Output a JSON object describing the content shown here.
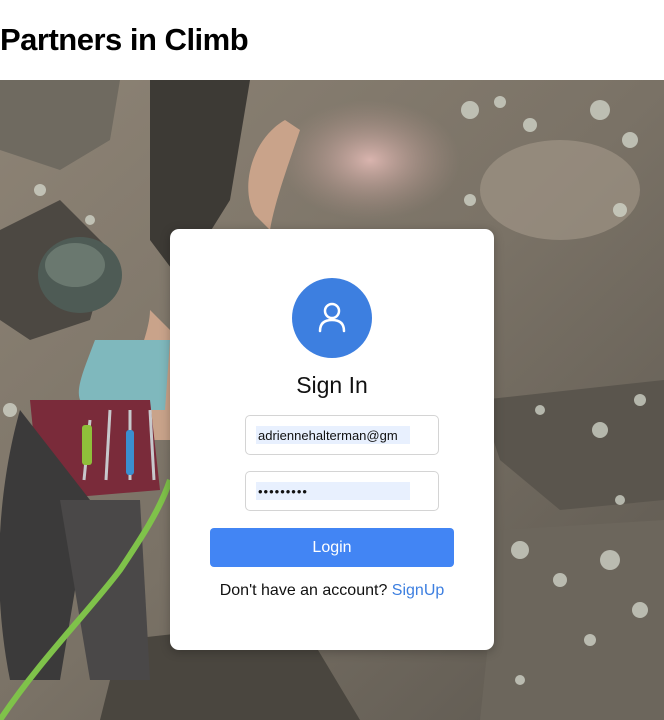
{
  "header": {
    "title": "Partners in Climb"
  },
  "hero": {
    "image_description": "rock climber photo background"
  },
  "login_card": {
    "avatar_icon": "user-icon",
    "title": "Sign In",
    "email_value": "adriennehalterman@gm",
    "password_value": "•••••••••",
    "login_label": "Login",
    "signup_prompt": "Don't have an account?",
    "signup_link": "SignUp"
  },
  "colors": {
    "accent": "#4285f4",
    "avatar_bg": "#3d7fe0",
    "link": "#3d7fe0",
    "autofill_bg": "#e8f0fe"
  }
}
